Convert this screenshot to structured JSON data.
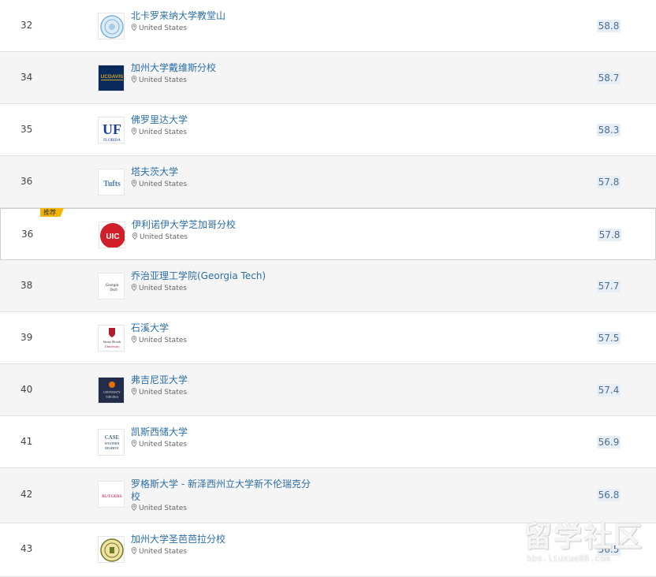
{
  "ranking": {
    "rows": [
      {
        "rank": "32",
        "name": "北卡罗来纳大学教堂山",
        "location": "United States",
        "score": "58.8",
        "logo_icon": "unc-seal-icon",
        "logo_text": ""
      },
      {
        "rank": "34",
        "name": "加州大学戴维斯分校",
        "location": "United States",
        "score": "58.7",
        "logo_icon": "uc-davis-logo-icon",
        "logo_text": "UCDAVIS"
      },
      {
        "rank": "35",
        "name": "佛罗里达大学",
        "location": "United States",
        "score": "58.3",
        "logo_icon": "uf-logo-icon",
        "logo_text": "UF",
        "logo_sub": "FLORIDA"
      },
      {
        "rank": "36",
        "name": "塔夫茨大学",
        "location": "United States",
        "score": "57.8",
        "logo_icon": "tufts-logo-icon",
        "logo_text": "Tufts"
      },
      {
        "rank": "36",
        "name": "伊利诺伊大学芝加哥分校",
        "location": "United States",
        "score": "57.8",
        "logo_icon": "uic-logo-icon",
        "logo_text": "UIC",
        "badge": "推荐"
      },
      {
        "rank": "38",
        "name": "乔治亚理工学院(Georgia Tech)",
        "location": "United States",
        "score": "57.7",
        "logo_icon": "georgia-tech-logo-icon",
        "logo_text": "Georgia Tech"
      },
      {
        "rank": "39",
        "name": "石溪大学",
        "location": "United States",
        "score": "57.5",
        "logo_icon": "stony-brook-logo-icon",
        "logo_text": "Stony Brook",
        "logo_sub": "University"
      },
      {
        "rank": "40",
        "name": "弗吉尼亚大学",
        "location": "United States",
        "score": "57.4",
        "logo_icon": "uva-logo-icon",
        "logo_text": "UNIVERSITY",
        "logo_sub": "VIRGINIA"
      },
      {
        "rank": "41",
        "name": "凯斯西储大学",
        "location": "United States",
        "score": "56.9",
        "logo_icon": "case-western-logo-icon",
        "logo_text": "CASE",
        "logo_sub": "WESTERN RESERVE"
      },
      {
        "rank": "42",
        "name": "罗格斯大学 - 新泽西州立大学新不伦瑞克分校",
        "location": "United States",
        "score": "56.8",
        "logo_icon": "rutgers-logo-icon",
        "logo_text": "RUTGERS"
      },
      {
        "rank": "43",
        "name": "加州大学圣芭芭拉分校",
        "location": "United States",
        "score": "56.5",
        "logo_icon": "ucsb-seal-icon",
        "logo_text": ""
      }
    ]
  },
  "watermark": {
    "logo": "留学社区",
    "url": "bbs.liuxue86.com"
  },
  "colors": {
    "link": "#2a6ea6",
    "score_bg": "#e8eef5",
    "score_text": "#4b6f91",
    "badge": "#f5b400",
    "row_alt": "#f5f5f5"
  }
}
